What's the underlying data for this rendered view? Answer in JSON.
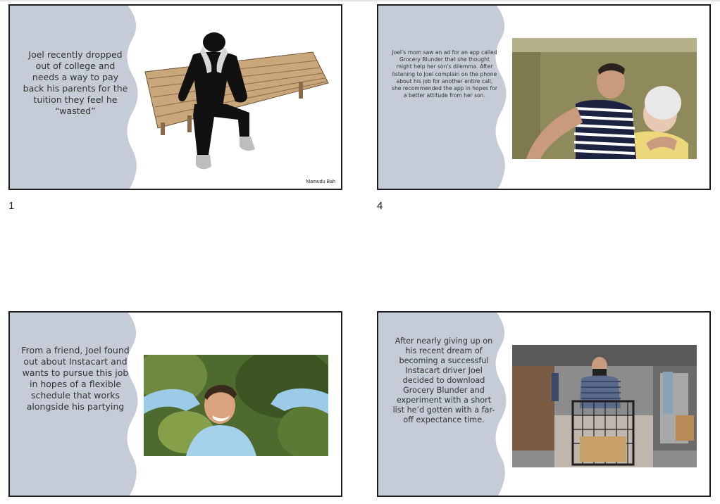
{
  "slides": [
    {
      "number": "1",
      "text": "Joel recently dropped out of college and needs a way to pay back his parents for the tuition they feel he “wasted”",
      "credit": "Mamudu Bah"
    },
    {
      "number": "4",
      "text": "Joel’s mom saw an ad for an app called Grocery Blunder that she thought might help her son’s dilemma. After listening to Joel complain on the phone about his job for another entire call, she recommended the app in hopes for a better attitude from her son."
    },
    {
      "text": "From a friend, Joel found out about Instacart and wants to pursue this job in hopes of a flexible schedule that works alongside his partying"
    },
    {
      "text": "After nearly giving up on his recent dream of becoming a successful Instacart driver Joel decided to download Grocery Blunder and experiment with a short list he’d gotten with a far-off expectance time."
    }
  ],
  "colors": {
    "band": "#c6cbd8",
    "border": "#1e1e1e"
  }
}
